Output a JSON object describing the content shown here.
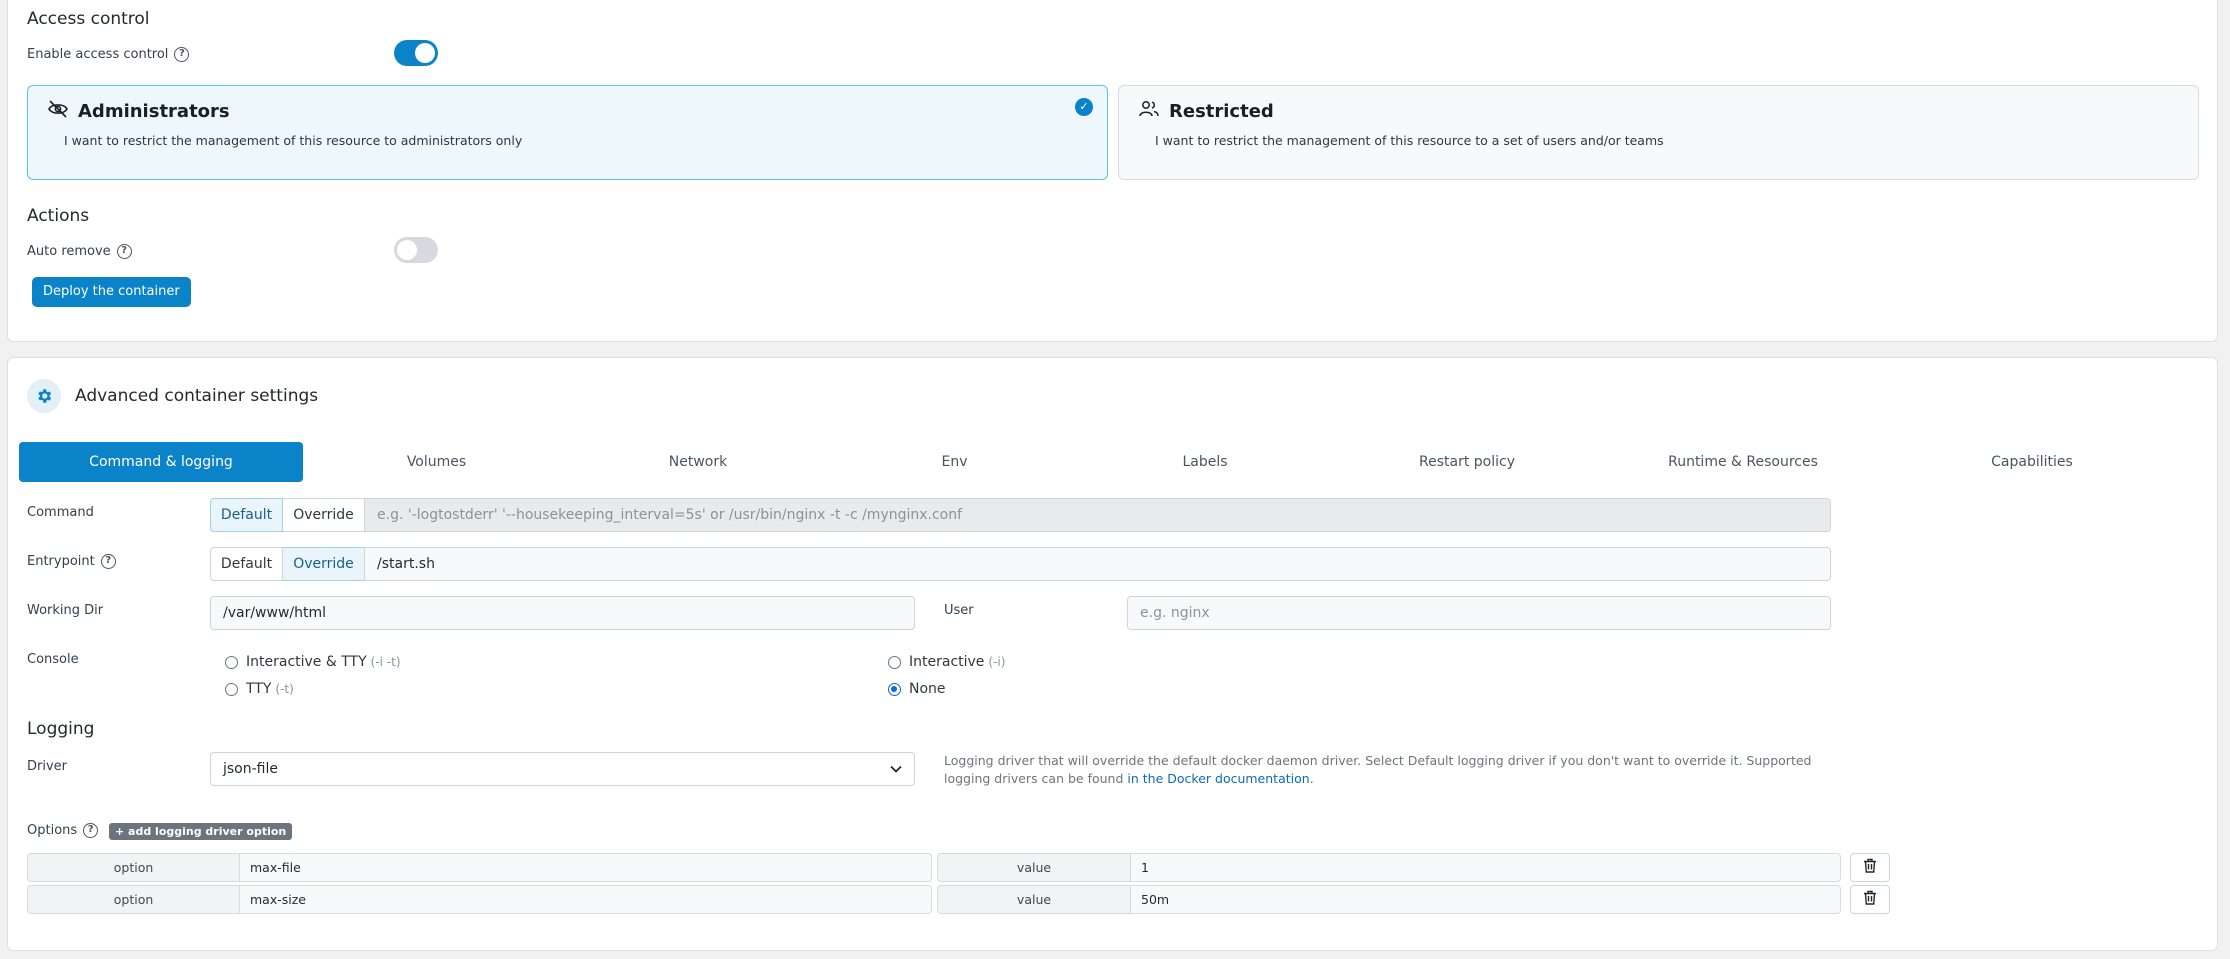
{
  "access_control": {
    "title": "Access control",
    "enable_label": "Enable access control",
    "enabled": true,
    "admin_card": {
      "title": "Administrators",
      "description": "I want to restrict the management of this resource to administrators only",
      "selected": true
    },
    "restricted_card": {
      "title": "Restricted",
      "description": "I want to restrict the management of this resource to a set of users and/or teams",
      "selected": false
    }
  },
  "actions": {
    "title": "Actions",
    "auto_remove_label": "Auto remove",
    "auto_remove": false,
    "deploy_label": "Deploy the container"
  },
  "advanced": {
    "title": "Advanced container settings",
    "tabs": [
      {
        "label": "Command & logging",
        "active": true
      },
      {
        "label": "Volumes",
        "active": false
      },
      {
        "label": "Network",
        "active": false
      },
      {
        "label": "Env",
        "active": false
      },
      {
        "label": "Labels",
        "active": false
      },
      {
        "label": "Restart policy",
        "active": false
      },
      {
        "label": "Runtime & Resources",
        "active": false
      },
      {
        "label": "Capabilities",
        "active": false
      }
    ]
  },
  "command": {
    "label": "Command",
    "default_label": "Default",
    "override_label": "Override",
    "placeholder": "e.g. '-logtostderr' '--housekeeping_interval=5s' or /usr/bin/nginx -t -c /mynginx.conf"
  },
  "entrypoint": {
    "label": "Entrypoint",
    "default_label": "Default",
    "override_label": "Override",
    "value": "/start.sh"
  },
  "working_dir": {
    "label": "Working Dir",
    "value": "/var/www/html"
  },
  "user": {
    "label": "User",
    "placeholder": "e.g. nginx"
  },
  "console": {
    "label": "Console",
    "options": [
      {
        "label": "Interactive & TTY",
        "hint": "(-i -t)",
        "checked": false
      },
      {
        "label": "TTY",
        "hint": "(-t)",
        "checked": false
      },
      {
        "label": "Interactive",
        "hint": "(-i)",
        "checked": false
      },
      {
        "label": "None",
        "hint": "",
        "checked": true
      }
    ]
  },
  "logging": {
    "title": "Logging",
    "driver_label": "Driver",
    "driver_value": "json-file",
    "help_text": "Logging driver that will override the default docker daemon driver. Select Default logging driver if you don't want to override it. Supported logging drivers can be found",
    "help_link": "in the Docker documentation",
    "help_end": ".",
    "options_label": "Options",
    "add_option_label": "+ add logging driver option",
    "option_col_label": "option",
    "value_col_label": "value",
    "options": [
      {
        "option": "max-file",
        "value": "1"
      },
      {
        "option": "max-size",
        "value": "50m"
      }
    ]
  }
}
